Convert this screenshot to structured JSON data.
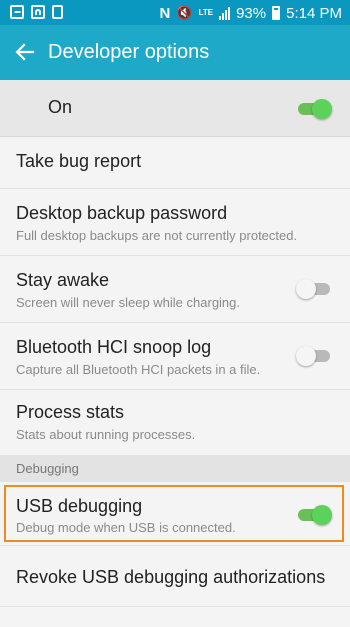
{
  "status_bar": {
    "battery": "93%",
    "time": "5:14 PM",
    "network": "LTE",
    "nfc": "N",
    "icons": [
      "photo-icon",
      "wifi-box-icon",
      "sd-card-icon",
      "nfc-icon",
      "mute-icon",
      "lte-icon",
      "signal-icon",
      "battery-icon"
    ]
  },
  "app_bar": {
    "title": "Developer options",
    "back_icon": "arrow-left-icon"
  },
  "master_toggle": {
    "label": "On",
    "state": "on"
  },
  "items": [
    {
      "title": "Take bug report"
    },
    {
      "title": "Desktop backup password",
      "subtitle": "Full desktop backups are not currently protected."
    },
    {
      "title": "Stay awake",
      "subtitle": "Screen will never sleep while charging.",
      "toggle": "off"
    },
    {
      "title": "Bluetooth HCI snoop log",
      "subtitle": "Capture all Bluetooth HCI packets in a file.",
      "toggle": "off"
    },
    {
      "title": "Process stats",
      "subtitle": "Stats about running processes."
    }
  ],
  "section_debugging": "Debugging",
  "debug_items": [
    {
      "title": "USB debugging",
      "subtitle": "Debug mode when USB is connected.",
      "toggle": "on",
      "highlighted": true
    },
    {
      "title": "Revoke USB debugging authorizations"
    }
  ],
  "colors": {
    "status_bar": "#0a97c0",
    "app_bar": "#1fa9c9",
    "toggle_on": "#5bd35a",
    "highlight": "#f08a1c"
  }
}
